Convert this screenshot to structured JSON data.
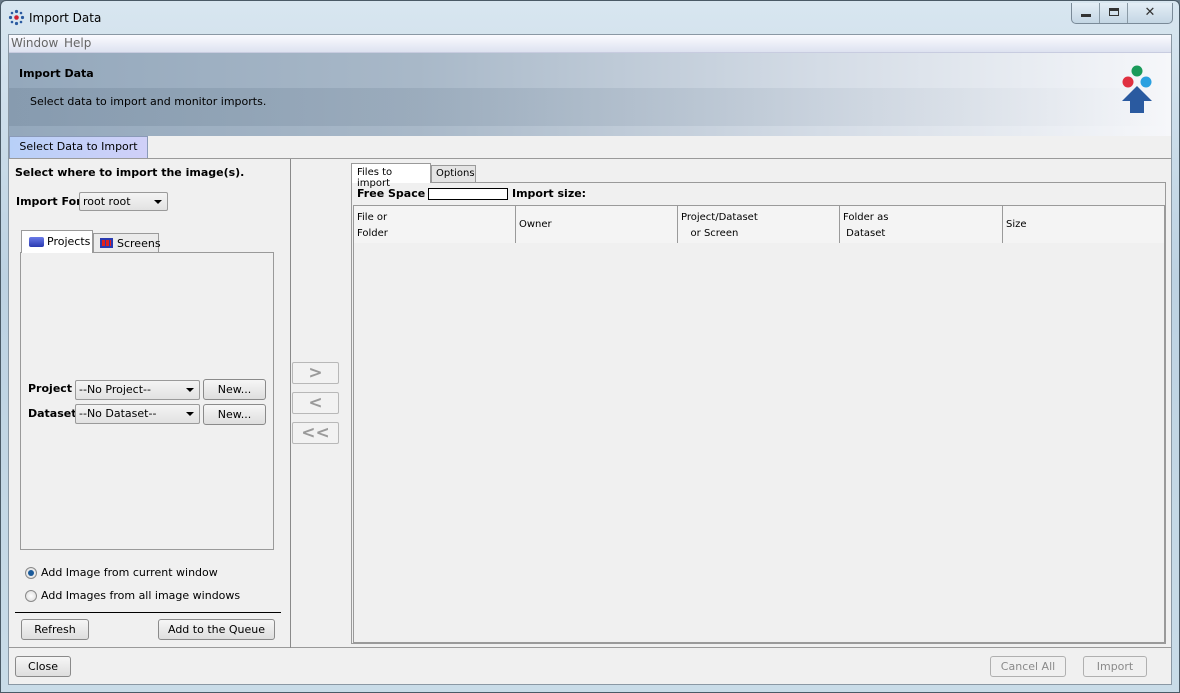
{
  "window": {
    "title": "Import Data",
    "controls": [
      "minimize",
      "maximize",
      "close"
    ]
  },
  "menu": [
    "Window",
    "Help"
  ],
  "header": {
    "title": "Import Data",
    "subtitle": "Select data to import and monitor imports.",
    "logo": "omero-import-logo"
  },
  "main_tab": "Select Data to Import",
  "left": {
    "heading": "Select where to import the image(s).",
    "import_for_label": "Import For",
    "import_for_value": "root root",
    "tabs": [
      "Projects",
      "Screens"
    ],
    "project_label": "Project",
    "project_value": "--No Project--",
    "dataset_label": "Dataset",
    "dataset_value": "--No Dataset--",
    "new_label": "New...",
    "radio_options": [
      {
        "label": "Add Image from current window",
        "checked": true
      },
      {
        "label": "Add Images from all image windows",
        "checked": false
      }
    ],
    "refresh": "Refresh",
    "add_queue": "Add to the Queue"
  },
  "transfer": {
    "add": ">",
    "remove": "<",
    "remove_all": "<<"
  },
  "right": {
    "tabs": [
      "Files to import",
      "Options"
    ],
    "free_space_label": "Free Space",
    "import_size_label": "Import size:",
    "columns": [
      [
        "File or",
        "Folder"
      ],
      [
        "Owner"
      ],
      [
        "Project/Dataset",
        "   or Screen"
      ],
      [
        "Folder as",
        " Dataset"
      ],
      [
        "Size"
      ]
    ]
  },
  "footer": {
    "close": "Close",
    "cancel_all": "Cancel All",
    "import": "Import"
  },
  "colors": {
    "accent_tab": "#c4d4f8",
    "logo_green": "#1a9a5a",
    "logo_red": "#e03040",
    "logo_blue": "#2aa0e0",
    "logo_arrow": "#2a5aa0"
  }
}
